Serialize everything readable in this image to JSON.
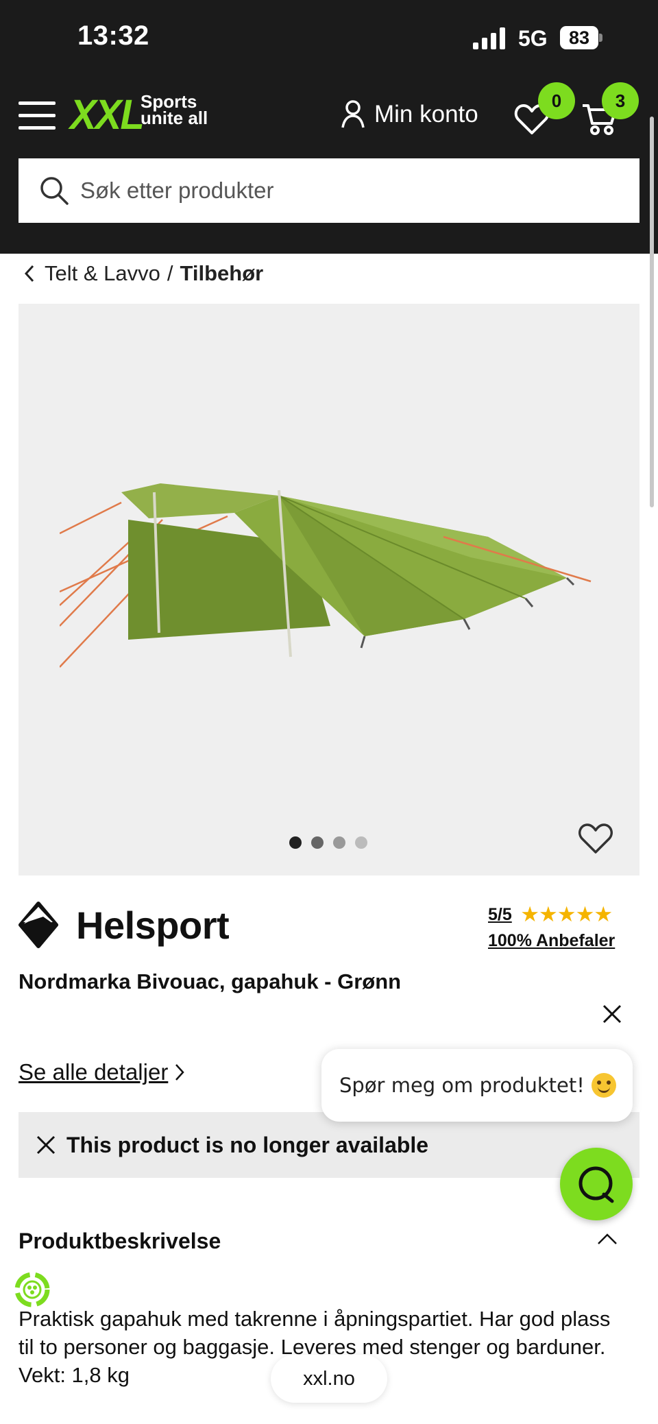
{
  "status_bar": {
    "time": "13:32",
    "network": "5G",
    "battery": "83"
  },
  "header": {
    "logo": "XXL",
    "tagline_line1": "Sports",
    "tagline_line2": "unite all",
    "account_label": "Min konto",
    "wishlist_count": "0",
    "cart_count": "3",
    "accent_color": "#7ddc1f"
  },
  "search": {
    "placeholder": "Søk etter produkter"
  },
  "breadcrumb": {
    "parent": "Telt & Lavvo",
    "separator": "/",
    "current": "Tilbehør"
  },
  "gallery": {
    "image": "green-tarp-shelter",
    "image_count": 4,
    "active_index": 0
  },
  "product": {
    "brand": "Helsport",
    "rating": "5/5",
    "stars": "★★★★★",
    "recommend": "100% Anbefaler",
    "title": "Nordmarka Bivouac, gapahuk - Grønn",
    "details_link": "Se alle detaljer",
    "unavailable": "This product is no longer available"
  },
  "chat": {
    "prompt": "Spør meg om produktet!"
  },
  "description": {
    "heading": "Produktbeskrivelse",
    "text": "Praktisk gapahuk med takrenne i åpningspartiet. Har god plass til to personer og baggasje. Leveres med stenger og barduner. Vekt: 1,8 kg"
  },
  "browser": {
    "url": "xxl.no"
  }
}
